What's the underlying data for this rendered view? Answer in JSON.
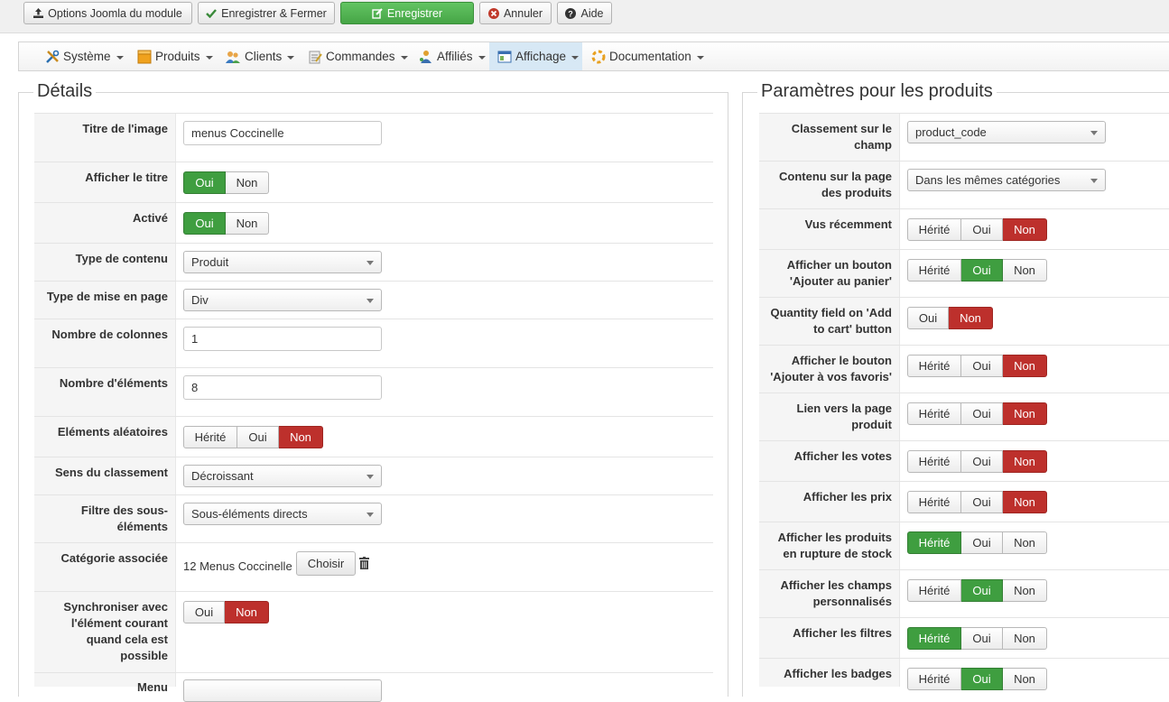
{
  "toolbar": {
    "options": "Options Joomla du module",
    "save_close": "Enregistrer & Fermer",
    "save": "Enregistrer",
    "cancel": "Annuler",
    "help": "Aide"
  },
  "menu": {
    "items": [
      {
        "label": "Système"
      },
      {
        "label": "Produits"
      },
      {
        "label": "Clients"
      },
      {
        "label": "Commandes"
      },
      {
        "label": "Affiliés"
      },
      {
        "label": "Affichage",
        "active": true
      },
      {
        "label": "Documentation"
      }
    ]
  },
  "details": {
    "legend": "Détails",
    "title_label": "Titre de l'image",
    "title_value": "menus Coccinelle",
    "show_title_label": "Afficher le titre",
    "active_label": "Activé",
    "content_type_label": "Type de contenu",
    "content_type_value": "Produit",
    "layout_type_label": "Type de mise en page",
    "layout_type_value": "Div",
    "columns_label": "Nombre de colonnes",
    "columns_value": "1",
    "elements_label": "Nombre d'éléments",
    "elements_value": "8",
    "random_label": "Eléments aléatoires",
    "order_dir_label": "Sens du classement",
    "order_dir_value": "Décroissant",
    "subfilter_label": "Filtre des sous-éléments",
    "subfilter_value": "Sous-éléments directs",
    "category_label": "Catégorie associée",
    "category_value": "12 Menus Coccinelle",
    "choose": "Choisir",
    "sync_label": "Synchroniser avec l'élément courant quand cela est possible",
    "menu_label": "Menu"
  },
  "labels": {
    "oui": "Oui",
    "non": "Non",
    "herite": "Hérité"
  },
  "products": {
    "legend": "Paramètres pour les produits",
    "sort_label": "Classement sur le champ",
    "sort_value": "product_code",
    "content_label": "Contenu sur la page des produits",
    "content_value": "Dans les mêmes catégories",
    "recent_label": "Vus récemment",
    "add_cart_label": "Afficher un bouton 'Ajouter au panier'",
    "qty_label": "Quantity field on 'Add to cart' button",
    "wishlist_label": "Afficher le bouton 'Ajouter à vos favoris'",
    "link_label": "Lien vers la page produit",
    "votes_label": "Afficher les votes",
    "prices_label": "Afficher les prix",
    "outstock_label": "Afficher les produits en rupture de stock",
    "custom_label": "Afficher les champs personnalisés",
    "filters_label": "Afficher les filtres",
    "badges_label": "Afficher les badges"
  },
  "colors": {
    "green": "#3f9e40",
    "red": "#bd302c",
    "active_menu": "#d7e8f5"
  }
}
